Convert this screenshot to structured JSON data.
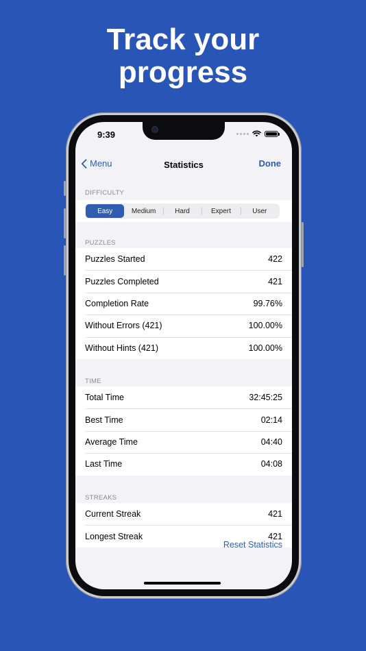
{
  "headline": {
    "line1": "Track your",
    "line2": "progress"
  },
  "status_bar": {
    "time": "9:39",
    "icons": [
      "signal-dots-icon",
      "wifi-icon",
      "battery-icon"
    ]
  },
  "nav": {
    "back_label": "Menu",
    "title": "Statistics",
    "done_label": "Done"
  },
  "difficulty": {
    "header": "DIFFICULTY",
    "options": [
      "Easy",
      "Medium",
      "Hard",
      "Expert",
      "User"
    ],
    "selected": "Easy"
  },
  "puzzles": {
    "header": "PUZZLES",
    "rows": [
      {
        "label": "Puzzles Started",
        "value": "422"
      },
      {
        "label": "Puzzles Completed",
        "value": "421"
      },
      {
        "label": "Completion Rate",
        "value": "99.76%"
      },
      {
        "label": "Without Errors (421)",
        "value": "100.00%"
      },
      {
        "label": "Without Hints (421)",
        "value": "100.00%"
      }
    ]
  },
  "time": {
    "header": "TIME",
    "rows": [
      {
        "label": "Total Time",
        "value": "32:45:25"
      },
      {
        "label": "Best Time",
        "value": "02:14"
      },
      {
        "label": "Average Time",
        "value": "04:40"
      },
      {
        "label": "Last Time",
        "value": "04:08"
      }
    ]
  },
  "streaks": {
    "header": "STREAKS",
    "rows": [
      {
        "label": "Current Streak",
        "value": "421"
      },
      {
        "label": "Longest Streak",
        "value": "421"
      }
    ]
  },
  "footer": {
    "reset_label": "Reset Statistics"
  },
  "colors": {
    "background": "#2855b6",
    "accent": "#2f5db1",
    "screen": "#f2f2f7"
  }
}
